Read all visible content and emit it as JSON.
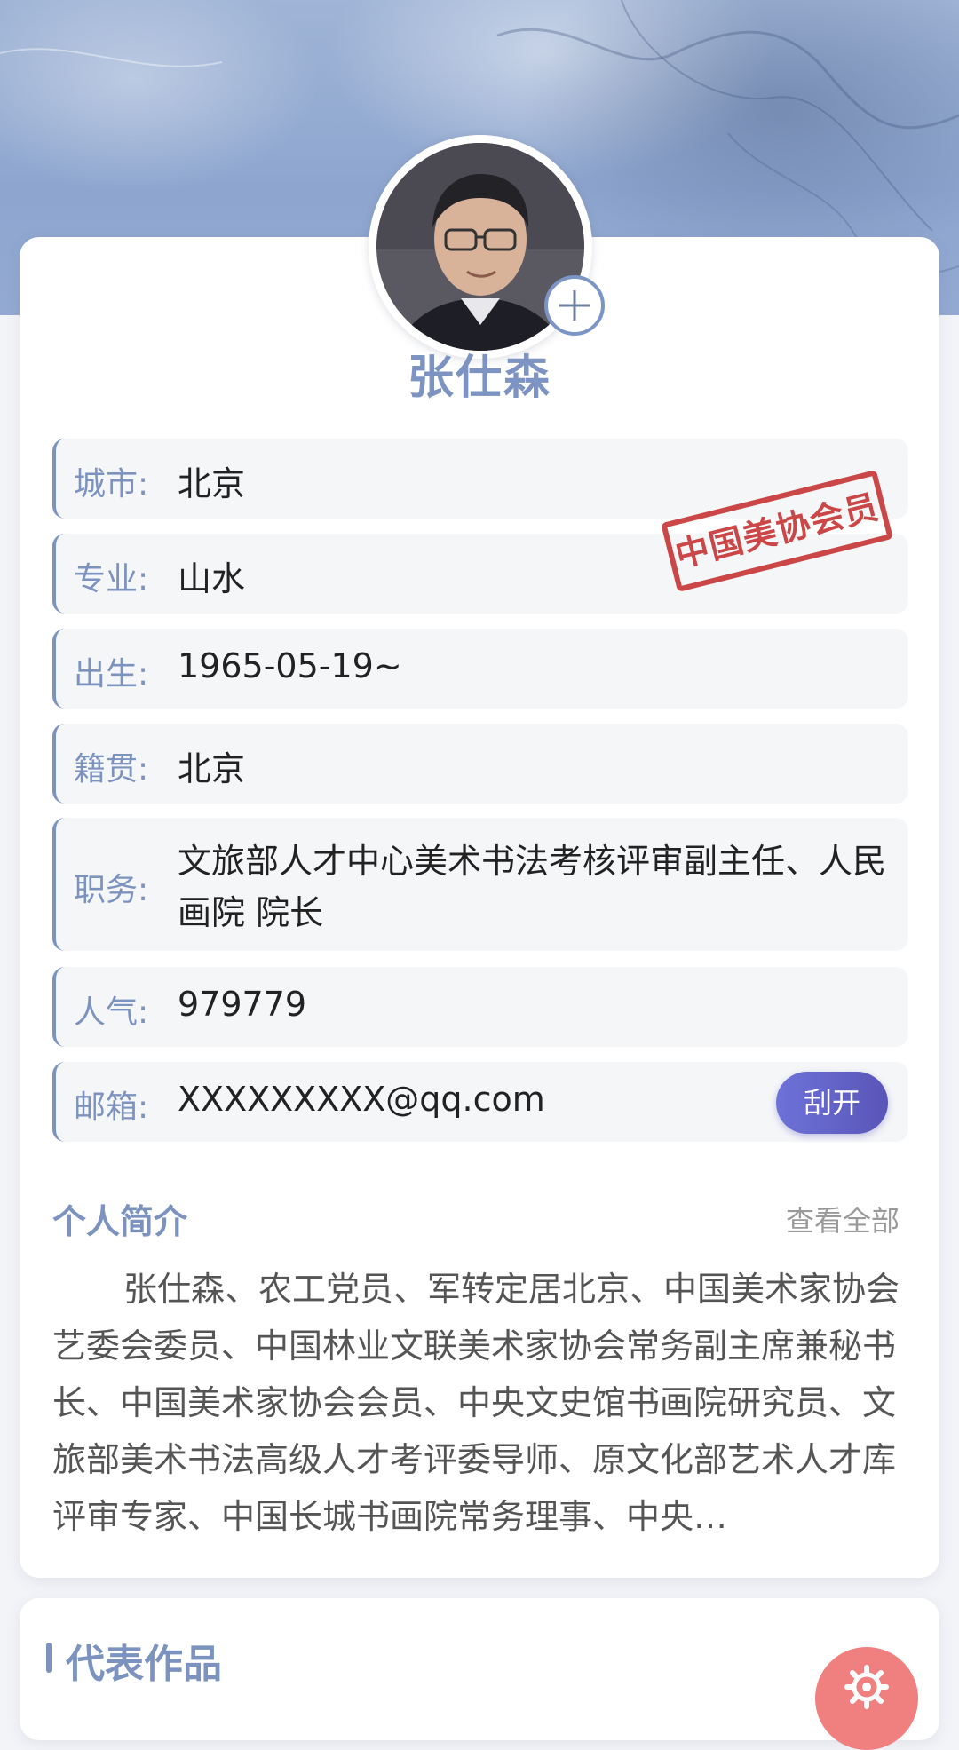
{
  "profile": {
    "name": "张仕森",
    "fields": [
      {
        "label": "城市:",
        "value": "北京"
      },
      {
        "label": "专业:",
        "value": "山水"
      },
      {
        "label": "出生:",
        "value": "1965-05-19~"
      },
      {
        "label": "籍贯:",
        "value": "北京"
      },
      {
        "label": "职务:",
        "value": "文旅部人才中心美术书法考核评审副主任、人民画院 院长"
      },
      {
        "label": "人气:",
        "value": "979779"
      },
      {
        "label": "邮箱:",
        "value": "XXXXXXXXX@qq.com"
      }
    ],
    "stamp_text": "中国美协会员",
    "scrape_button": "刮开"
  },
  "intro": {
    "title": "个人简介",
    "view_all": "查看全部",
    "text": "张仕森、农工党员、军转定居北京、中国美术家协会艺委会委员、中国林业文联美术家协会常务副主席兼秘书长、中国美术家协会会员、中央文史馆书画院研究员、文旅部美术书法高级人才考评委导师、原文化部艺术人才库评审专家、中国长城书画院常务理事、中央…"
  },
  "works": {
    "title": "代表作品"
  },
  "icons": {
    "add": "plus-icon",
    "fab": "gear-icon"
  },
  "colors": {
    "accent": "#7c93bf",
    "stamp": "#c73434",
    "button": "#6d72d8",
    "fab": "#f07f7f"
  }
}
